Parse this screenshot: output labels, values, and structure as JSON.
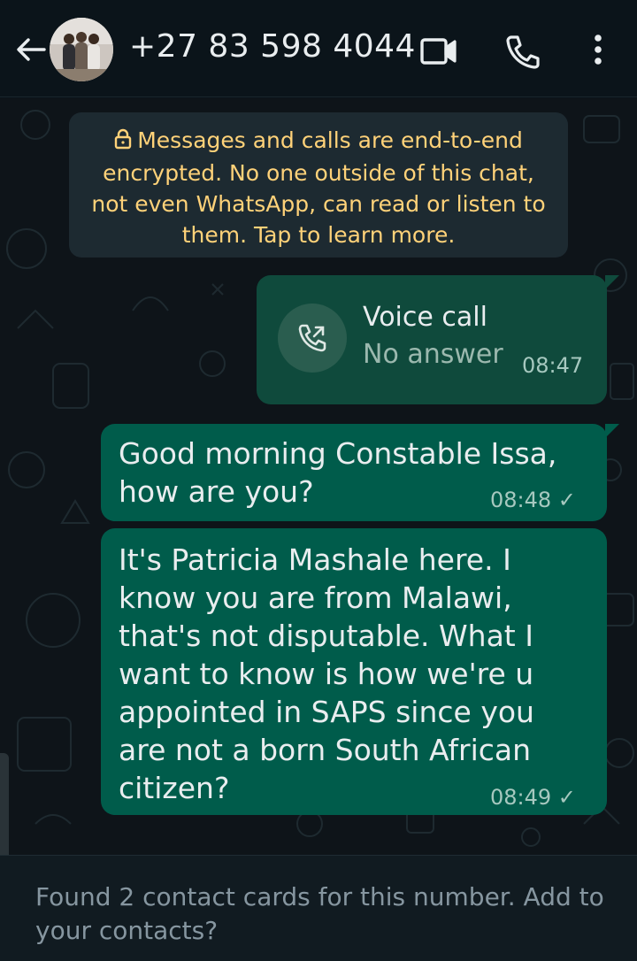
{
  "header": {
    "contact_name": "+27 83 598 4044",
    "icons": [
      "back-arrow-icon",
      "video-call-icon",
      "voice-call-icon",
      "more-options-icon"
    ]
  },
  "encryption_notice": {
    "text": "Messages and calls are end-to-end encrypted. No one outside of this chat, not even WhatsApp, can read or listen to them. Tap to learn more.",
    "color": "#ffd279"
  },
  "messages": [
    {
      "type": "call",
      "title": "Voice call",
      "status": "No answer",
      "time": "08:47"
    },
    {
      "type": "text",
      "lines": [
        "Good morning Constable Issa,",
        "how are you?"
      ],
      "time": "08:48 ✓"
    },
    {
      "type": "text",
      "lines": [
        "It's Patricia Mashale here. I",
        "know you are from Malawi,",
        "that's not disputable. What I",
        "want to know is how we're u",
        "appointed in SAPS since you",
        "are not a born South African",
        "citizen?"
      ],
      "time": "08:49 ✓"
    }
  ],
  "footer": {
    "text": "Found 2 contact cards for this number. Add to your contacts?"
  },
  "colors": {
    "background": "#0b141a",
    "outgoing_bubble": "#005c4b",
    "notice_bg": "#1d2a31"
  }
}
